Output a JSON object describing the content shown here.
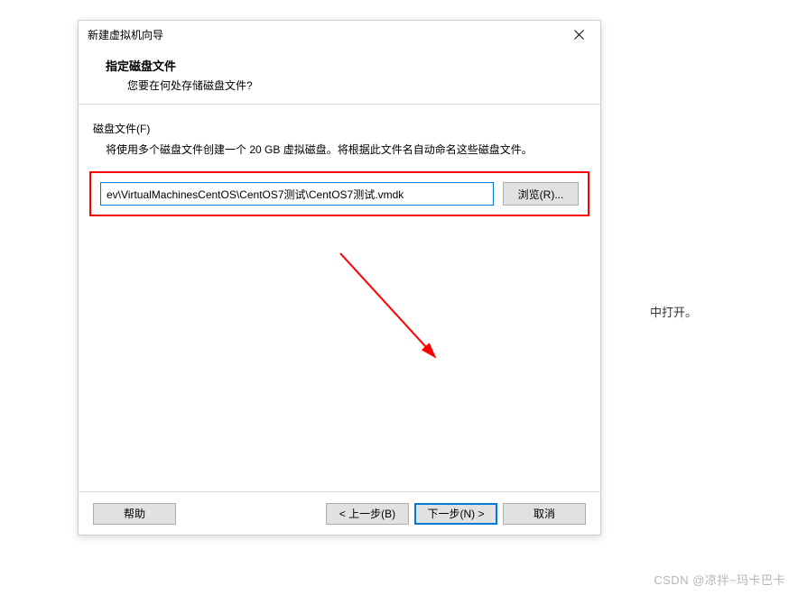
{
  "dialog": {
    "title": "新建虚拟机向导",
    "header_title": "指定磁盘文件",
    "header_subtitle": "您要在何处存储磁盘文件?",
    "fieldset_label": "磁盘文件(F)",
    "description": "将使用多个磁盘文件创建一个 20 GB 虚拟磁盘。将根据此文件名自动命名这些磁盘文件。",
    "path_value": "ev\\VirtualMachinesCentOS\\CentOS7测试\\CentOS7测试.vmdk",
    "browse_label": "浏览(R)...",
    "help_label": "帮助",
    "back_label": "< 上一步(B)",
    "next_label": "下一步(N) >",
    "cancel_label": "取消"
  },
  "outside": {
    "snippet": "中打开。"
  },
  "watermark": "CSDN @凉拌~玛卡巴卡"
}
